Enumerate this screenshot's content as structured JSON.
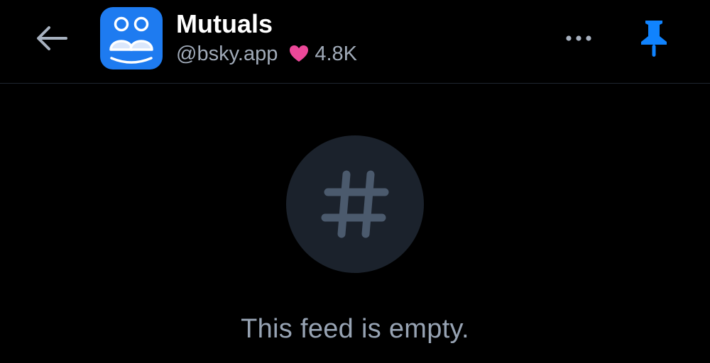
{
  "header": {
    "title": "Mutuals",
    "handle": "@bsky.app",
    "like_count": "4.8K"
  },
  "icons": {
    "back": "arrow-left-icon",
    "avatar": "mutuals-feed-avatar",
    "heart": "heart-icon",
    "more": "ellipsis-icon",
    "pin": "pin-icon",
    "empty": "hashtag-icon"
  },
  "empty_state": {
    "message": "This feed is empty."
  },
  "colors": {
    "background": "#000000",
    "avatar_blue": "#1e7bf0",
    "heart_pink": "#ec4899",
    "pin_blue": "#1083fe",
    "muted_text": "#97a3b3",
    "empty_circle": "#1b222c",
    "hash_glyph": "#4b5a6d"
  }
}
